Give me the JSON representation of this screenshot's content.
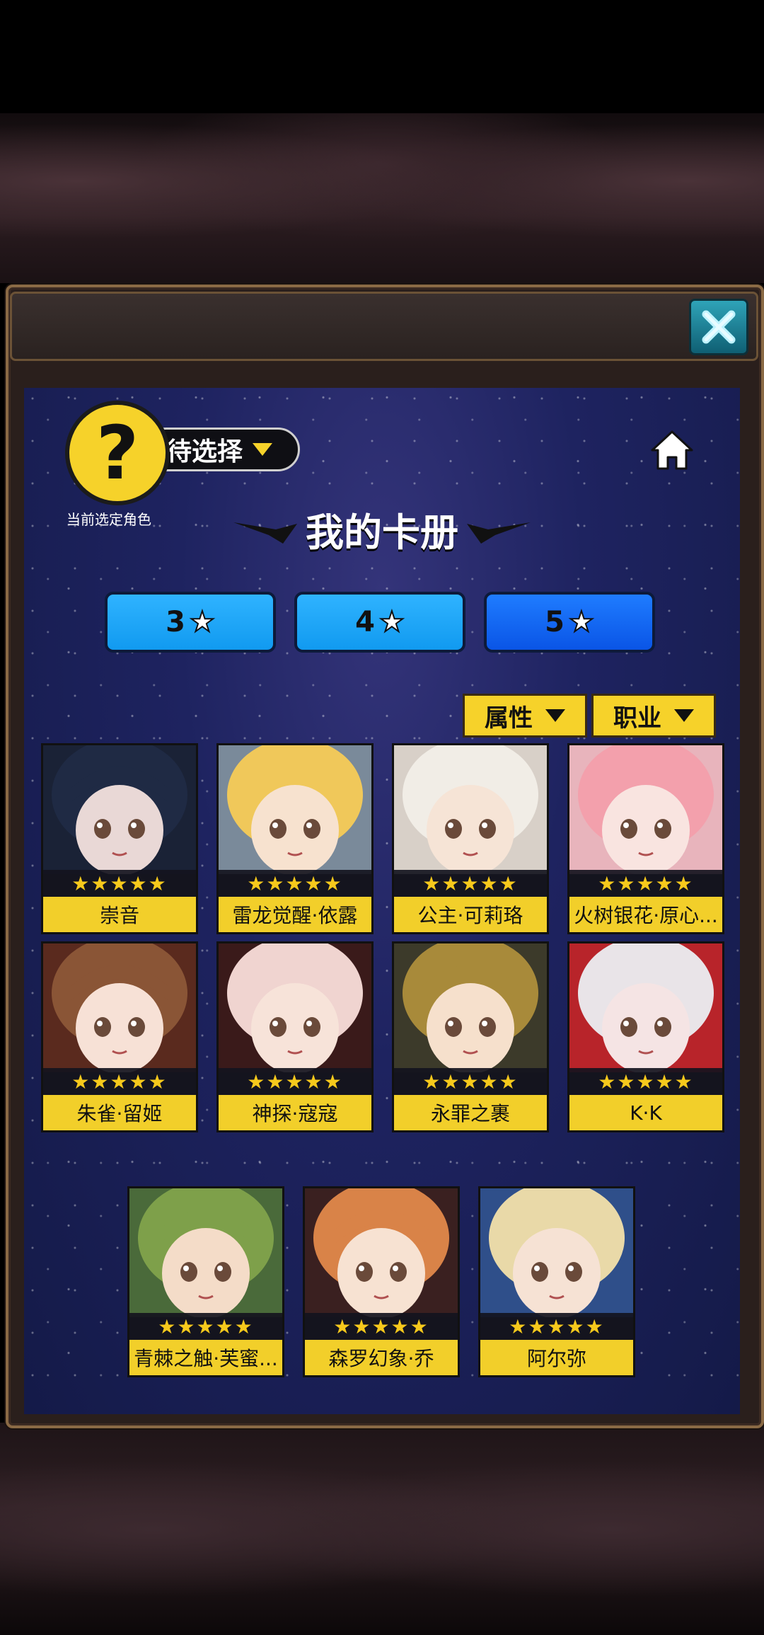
{
  "header": {
    "selected_status": "待选择",
    "current_label": "当前选定角色",
    "avatar_glyph": "?"
  },
  "book": {
    "title": "我的卡册"
  },
  "star_tabs": [
    {
      "label": "3",
      "star": "★"
    },
    {
      "label": "4",
      "star": "★"
    },
    {
      "label": "5",
      "star": "★",
      "active": true
    }
  ],
  "filters": {
    "attribute": "属性",
    "profession": "职业"
  },
  "cards": [
    {
      "name": "崇音",
      "stars": "★★★★★",
      "hair": "#1f2a44",
      "skin": "#e9d8d6",
      "bg": "#1a2236"
    },
    {
      "name": "雷龙觉醒·依露",
      "stars": "★★★★★",
      "hair": "#f0c85a",
      "skin": "#f7e2cf",
      "bg": "#7a8a9a"
    },
    {
      "name": "公主·可莉珞",
      "stars": "★★★★★",
      "hair": "#f1ede6",
      "skin": "#f6e4d6",
      "bg": "#d8d0c8"
    },
    {
      "name": "火树银花·原心...",
      "stars": "★★★★★",
      "hair": "#f3a0ac",
      "skin": "#f9e4e0",
      "bg": "#e8b4bc"
    },
    {
      "name": "朱雀·留姬",
      "stars": "★★★★★",
      "hair": "#8a5536",
      "skin": "#f7e1d6",
      "bg": "#5a2a1e"
    },
    {
      "name": "神探·寇寇",
      "stars": "★★★★★",
      "hair": "#f0d4d0",
      "skin": "#f7e3d9",
      "bg": "#3a1a1a"
    },
    {
      "name": "永罪之裹",
      "stars": "★★★★★",
      "hair": "#a88a3a",
      "skin": "#f6e0cc",
      "bg": "#3c3a2a"
    },
    {
      "name": "K·K",
      "stars": "★★★★★",
      "hair": "#e9e4e8",
      "skin": "#f5e4e4",
      "bg": "#b8242a"
    },
    {
      "name": "青棘之触·芙蜜...",
      "stars": "★★★★★",
      "hair": "#7ea04a",
      "skin": "#f4dcc8",
      "bg": "#4a6a3a"
    },
    {
      "name": "森罗幻象·乔",
      "stars": "★★★★★",
      "hair": "#d98348",
      "skin": "#f7e2d2",
      "bg": "#3a2020"
    },
    {
      "name": "阿尔弥",
      "stars": "★★★★★",
      "hair": "#e9d9a8",
      "skin": "#f6e2d4",
      "bg": "#2f4f8a"
    }
  ],
  "colors": {
    "accent_yellow": "#f6d22a",
    "tab_blue": "#2fb3ff",
    "tab_active": "#1f7cff",
    "close_teal": "#2fa3b8"
  }
}
